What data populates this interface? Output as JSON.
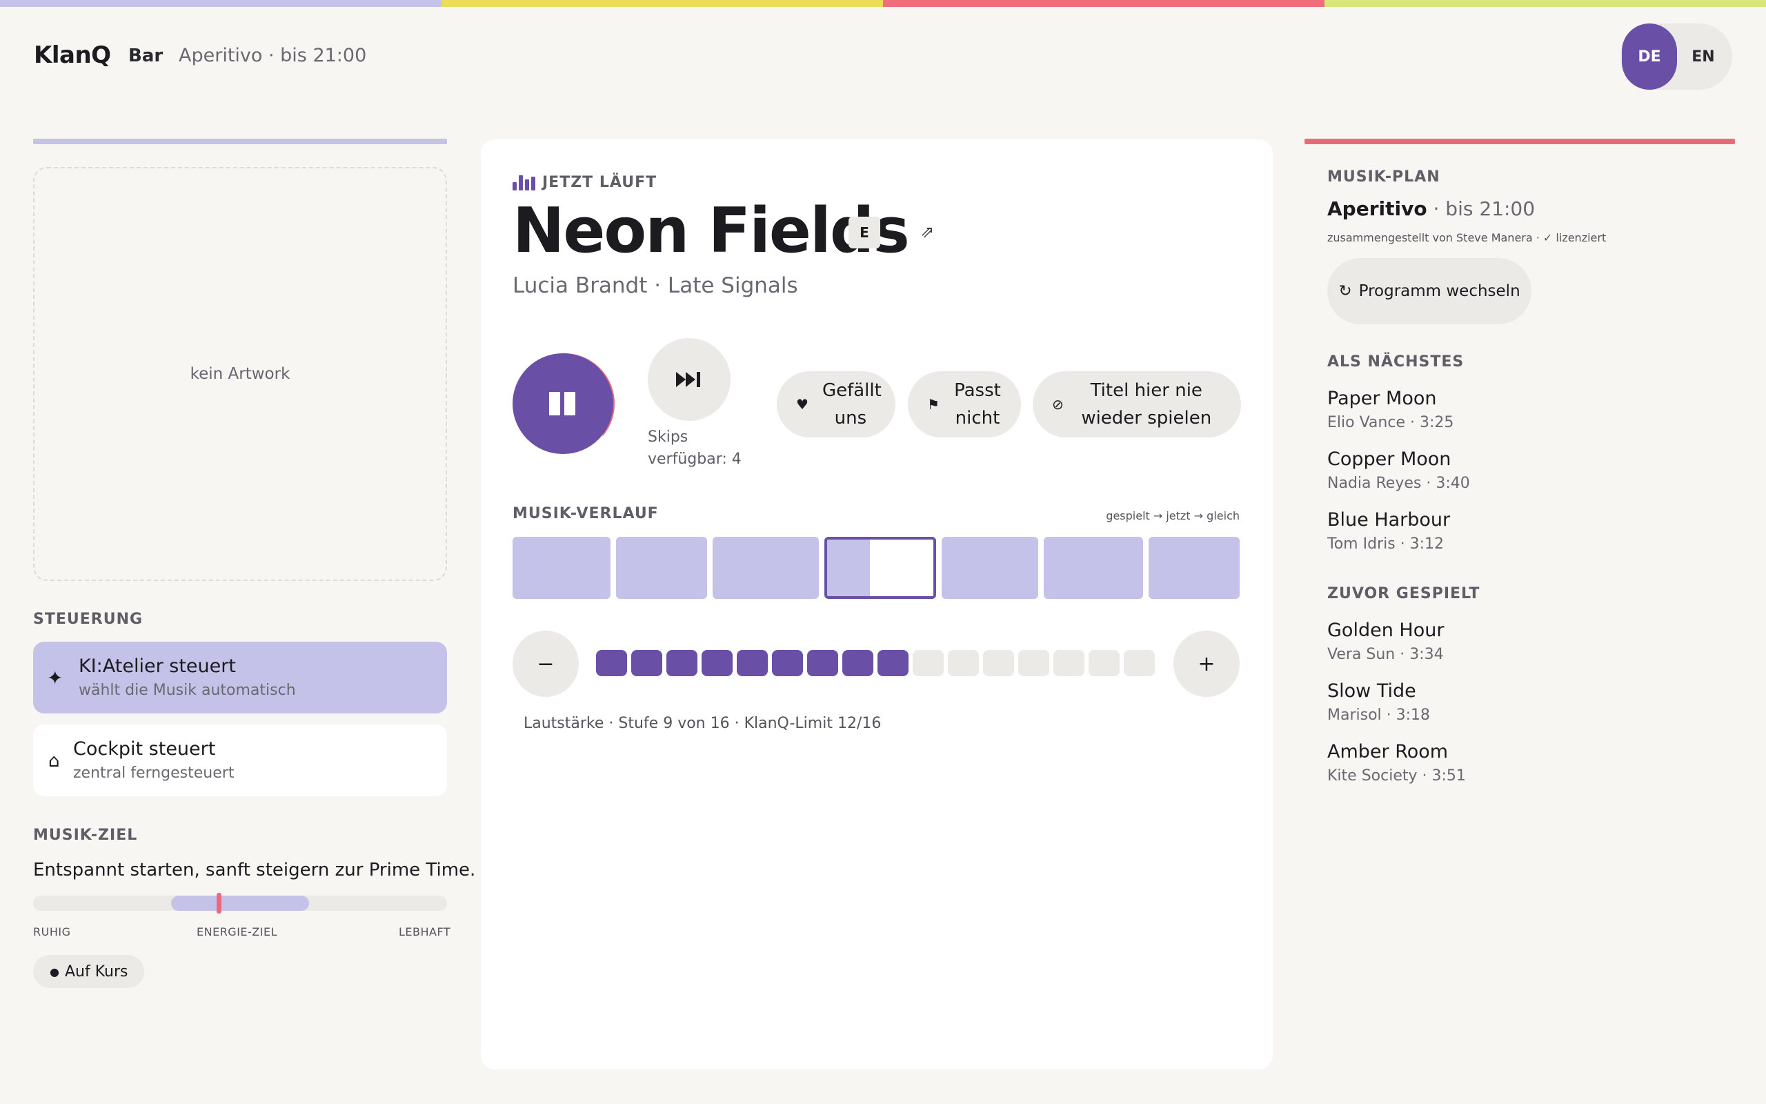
{
  "colors": {
    "strip": [
      "#c5c2ea",
      "#ecdc5a",
      "#ef6e7a",
      "#d9e67a"
    ],
    "accent": "#6a4fa6",
    "lavender": "#c5c2ea",
    "coral": "#e96a78",
    "neutral": "#ebeae6"
  },
  "header": {
    "app_name": "KlanQ",
    "venue": "Bar",
    "program": "Aperitivo · bis 21:00",
    "lang_de": "DE",
    "lang_en": "EN",
    "active_lang": "DE"
  },
  "artwork": {
    "placeholder": "kein Artwork"
  },
  "control": {
    "section_label": "STEUERUNG",
    "modes": [
      {
        "icon": "sparkle-icon",
        "title": "KI:Atelier steuert",
        "subtitle": "wählt die Musik automatisch",
        "active": true
      },
      {
        "icon": "home-icon",
        "title": "Cockpit steuert",
        "subtitle": "zentral ferngesteuert",
        "active": false
      }
    ]
  },
  "goal": {
    "section_label": "MUSIK-ZIEL",
    "text": "Entspannt starten, sanft steigern zur Prime Time.",
    "scale_low": "RUHIG",
    "scale_mid": "ENERGIE-ZIEL",
    "scale_high": "LEBHAFT",
    "target_range": [
      0.333,
      0.667
    ],
    "current_level": 0.45,
    "status": "Auf Kurs"
  },
  "now_playing": {
    "label": "JETZT LÄUFT",
    "title": "Neon Fields",
    "explicit": "E",
    "artist_album": "Lucia Brandt · Late Signals",
    "progress": 0.36,
    "skips_text": "Skips verfügbar: 4",
    "actions": [
      {
        "icon": "heart-icon",
        "label": "Gefällt uns"
      },
      {
        "icon": "flag-icon",
        "label": "Passt nicht"
      },
      {
        "icon": "block-icon",
        "label": "Titel hier nie wieder spielen"
      }
    ]
  },
  "history": {
    "label": "MUSIK-VERLAUF",
    "legend": "gespielt → jetzt → gleich",
    "current_index": 3,
    "current_progress": 0.4
  },
  "volume": {
    "minus": "−",
    "plus": "+",
    "level": 9,
    "max": 16,
    "limit": 12,
    "text": "Lautstärke · Stufe 9 von 16 · KlanQ-Limit 12/16"
  },
  "plan": {
    "section_label": "MUSIK-PLAN",
    "name": "Aperitivo",
    "until": " · bis 21:00",
    "curated": "zusammengestellt von Steve Manera · ✓ lizenziert",
    "switch_label": "Programm wechseln",
    "next_label": "ALS NÄCHSTES",
    "next": [
      {
        "title": "Paper Moon",
        "meta": "Elio Vance · 3:25"
      },
      {
        "title": "Copper Moon",
        "meta": "Nadia Reyes · 3:40"
      },
      {
        "title": "Blue Harbour",
        "meta": "Tom Idris · 3:12"
      }
    ],
    "prev_label": "ZUVOR GESPIELT",
    "previous": [
      {
        "title": "Golden Hour",
        "meta": "Vera Sun · 3:34"
      },
      {
        "title": "Slow Tide",
        "meta": "Marisol · 3:18"
      },
      {
        "title": "Amber Room",
        "meta": "Kite Society · 3:51"
      }
    ]
  }
}
